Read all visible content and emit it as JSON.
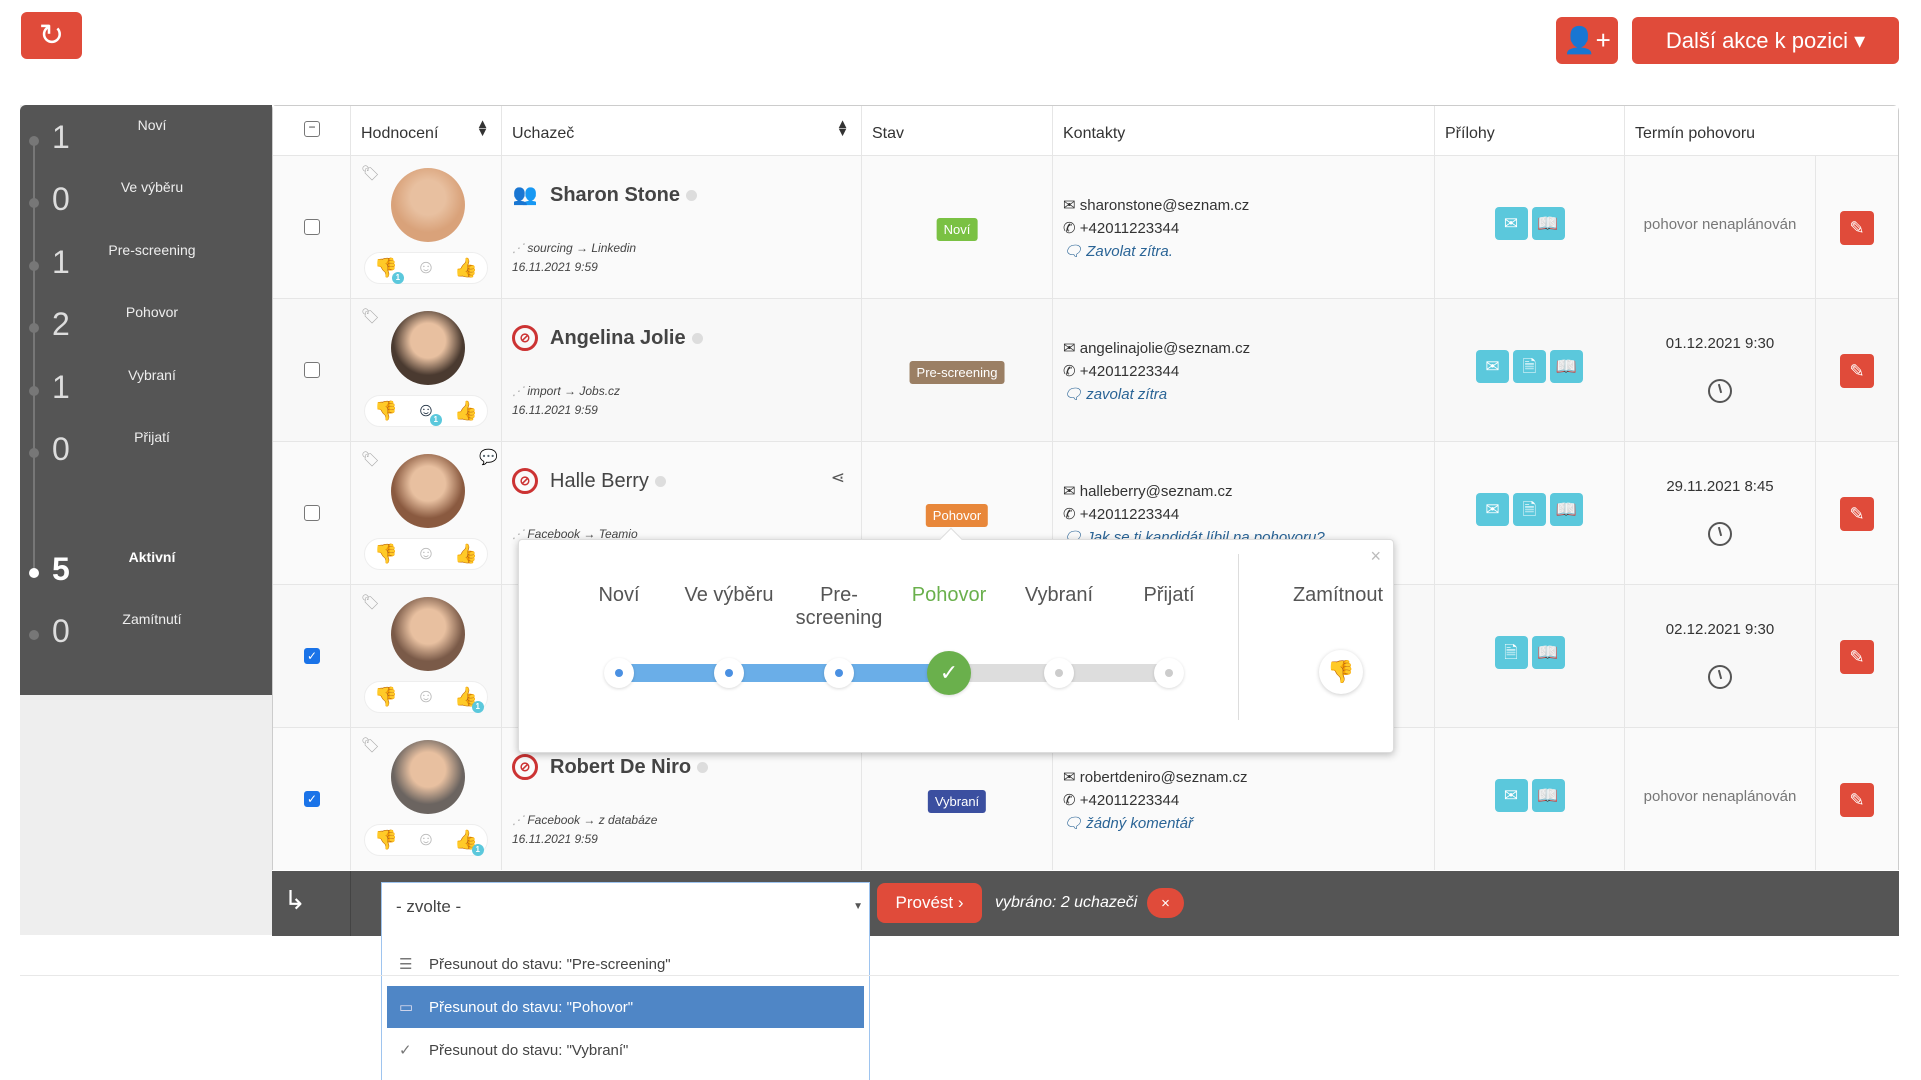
{
  "top": {
    "refresh_icon": "refresh-icon",
    "add_user_icon": "user-plus-icon",
    "more_actions": "Další akce k pozici ▾"
  },
  "sidebar": {
    "items": [
      {
        "count": "1",
        "label": "Noví"
      },
      {
        "count": "0",
        "label": "Ve výběru"
      },
      {
        "count": "1",
        "label": "Pre-screening"
      },
      {
        "count": "2",
        "label": "Pohovor"
      },
      {
        "count": "1",
        "label": "Vybraní"
      },
      {
        "count": "0",
        "label": "Přijatí"
      }
    ],
    "active": {
      "count": "5",
      "label": "Aktivní"
    },
    "rejected": {
      "count": "0",
      "label": "Zamítnutí"
    }
  },
  "table": {
    "headers": {
      "rating": "Hodnocení",
      "candidate": "Uchazeč",
      "status": "Stav",
      "contacts": "Kontakty",
      "attachments": "Přílohy",
      "interview": "Termín pohovoru"
    },
    "rows": [
      {
        "name": "Sharon Stone",
        "name_icon": "users-icon",
        "checked": false,
        "rating": "down",
        "rating_count": "1",
        "source": "sourcing → Linkedin",
        "date": "16.11.2021 9:59",
        "status": "Noví",
        "status_color": "#7ac143",
        "email": "sharonstone@seznam.cz",
        "phone": "+42011223344",
        "note": "Zavolat zítra.",
        "attachments": [
          "mail",
          "book"
        ],
        "interview": "pohovor nenaplánován",
        "clock": false,
        "avatar": "#d9a27a"
      },
      {
        "name": "Angelina Jolie",
        "name_icon": "no-contact-icon",
        "checked": false,
        "rating": "neutral",
        "rating_count": "1",
        "source": "import → Jobs.cz",
        "date": "16.11.2021 9:59",
        "status": "Pre-screening",
        "status_color": "#9b7f64",
        "email": "angelinajolie@seznam.cz",
        "phone": "+42011223344",
        "note": "zavolat zítra",
        "attachments": [
          "mail",
          "doc",
          "book"
        ],
        "interview": "01.12.2021 9:30",
        "clock": true,
        "avatar": "#4a3a30"
      },
      {
        "name": "Halle Berry",
        "name_icon": "no-contact-icon",
        "checked": false,
        "rating": "",
        "rating_count": "",
        "source": "Facebook → Teamio",
        "date": "",
        "status": "Pohovor",
        "status_color": "#e8873a",
        "email": "halleberry@seznam.cz",
        "phone": "+42011223344",
        "note": "Jak se ti kandidát líbil na pohovoru?",
        "attachments": [
          "mail",
          "doc",
          "book"
        ],
        "interview": "29.11.2021 8:45",
        "clock": true,
        "avatar": "#8a5a40",
        "comment": true,
        "share": true
      },
      {
        "name": "",
        "name_icon": "",
        "checked": true,
        "rating": "up",
        "rating_count": "1",
        "source": "",
        "date": "",
        "status": "",
        "status_color": "",
        "email": "",
        "phone": "",
        "note": "",
        "attachments": [
          "doc",
          "book"
        ],
        "interview": "02.12.2021 9:30",
        "clock": true,
        "avatar": "#7a5a48"
      },
      {
        "name": "Robert De Niro",
        "name_icon": "no-contact-icon",
        "checked": true,
        "rating": "up",
        "rating_count": "1",
        "source": "Facebook → z databáze",
        "date": "16.11.2021 9:59",
        "status": "Vybraní",
        "status_color": "#3b4fa0",
        "email": "robertdeniro@seznam.cz",
        "phone": "+42011223344",
        "note": "žádný komentář",
        "attachments": [
          "mail",
          "book"
        ],
        "interview": "pohovor nenaplánován",
        "clock": false,
        "avatar": "#6b6460"
      }
    ]
  },
  "bulk": {
    "select_value": "- zvolte -",
    "options": [
      {
        "icon": "list-icon",
        "label": "Přesunout do stavu: \"Pre-screening\""
      },
      {
        "icon": "calendar-icon",
        "label": "Přesunout do stavu: \"Pohovor\"",
        "highlighted": true
      },
      {
        "icon": "check-icon",
        "label": "Přesunout do stavu: \"Vybraní\""
      }
    ],
    "run": "Provést ›",
    "selected": "vybráno: 2 uchazeči",
    "clear": "×"
  },
  "popup": {
    "stages": [
      "Noví",
      "Ve výběru",
      "Pre-screening",
      "Pohovor",
      "Vybraní",
      "Přijatí"
    ],
    "current_index": 3,
    "reject": "Zamítnout",
    "close": "×"
  },
  "colors": {
    "accent": "#e04b3a",
    "attachment": "#5bc8dc",
    "current_stage": "#6ab04c",
    "progress": "#6aaee8"
  }
}
